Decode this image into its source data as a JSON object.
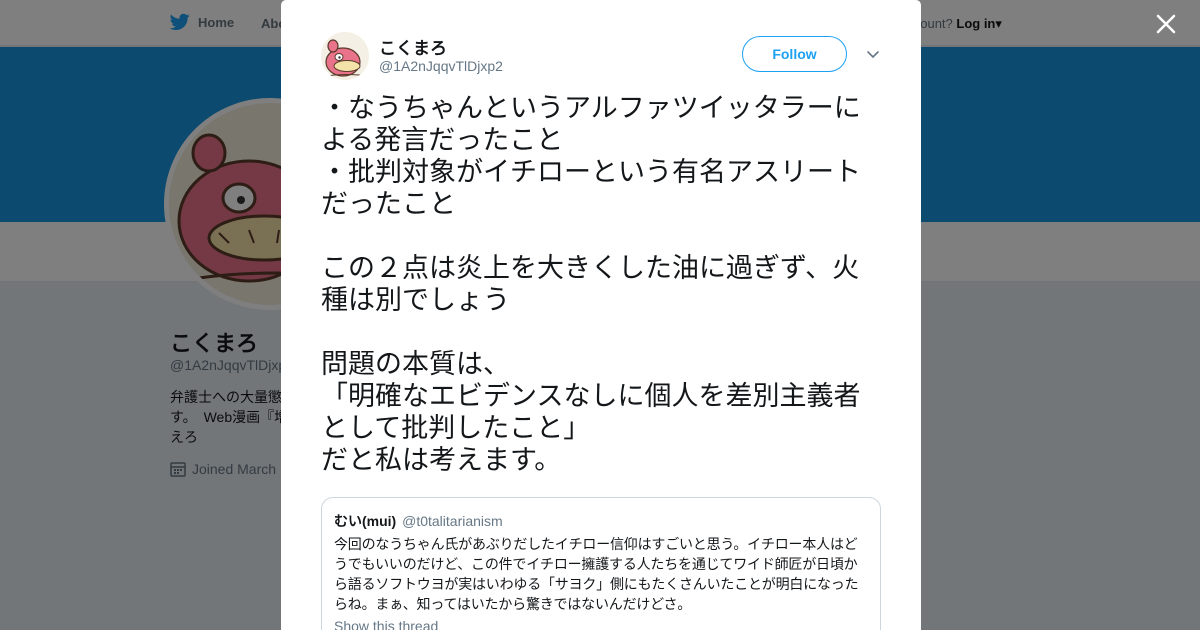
{
  "topbar": {
    "home_label": "Home",
    "about_label": "Abo",
    "account_prompt": "account?",
    "login_label": "Log in"
  },
  "profile": {
    "name": "こくまろ",
    "handle": "@1A2nJqqvTlDjxp",
    "bio": "弁護士への大量懲す。　Web漫画『増えろ",
    "joined": "Joined March"
  },
  "tweet": {
    "author_name": "こくまろ",
    "author_handle": "@1A2nJqqvTlDjxp2",
    "follow_label": "Follow",
    "text": "・なうちゃんというアルファツイッタラーによる発言だったこと\n・批判対象がイチローという有名アスリートだったこと\n\nこの２点は炎上を大きくした油に過ぎず、火種は別でしょう\n\n問題の本質は、\n「明確なエビデンスなしに個人を差別主義者として批判したこと」\nだと私は考えます。",
    "quote": {
      "name": "むい(mui)",
      "handle": "@t0talitarianism",
      "text": "今回のなうちゃん氏があぶりだしたイチロー信仰はすごいと思う。イチロー本人はどうでもいいのだけど、この件でイチロー擁護する人たちを通じてワイド師匠が日頃から語るソフトウヨが実はいわゆる「サヨク」側にもたくさんいたことが明白になったらね。まぁ、知ってはいたから驚きではないんだけどさ。",
      "show_thread": "Show this thread"
    }
  },
  "colors": {
    "brand_blue": "#1da1f2",
    "banner_blue": "#1b95e0",
    "avatar_pink": "#e8738a"
  }
}
